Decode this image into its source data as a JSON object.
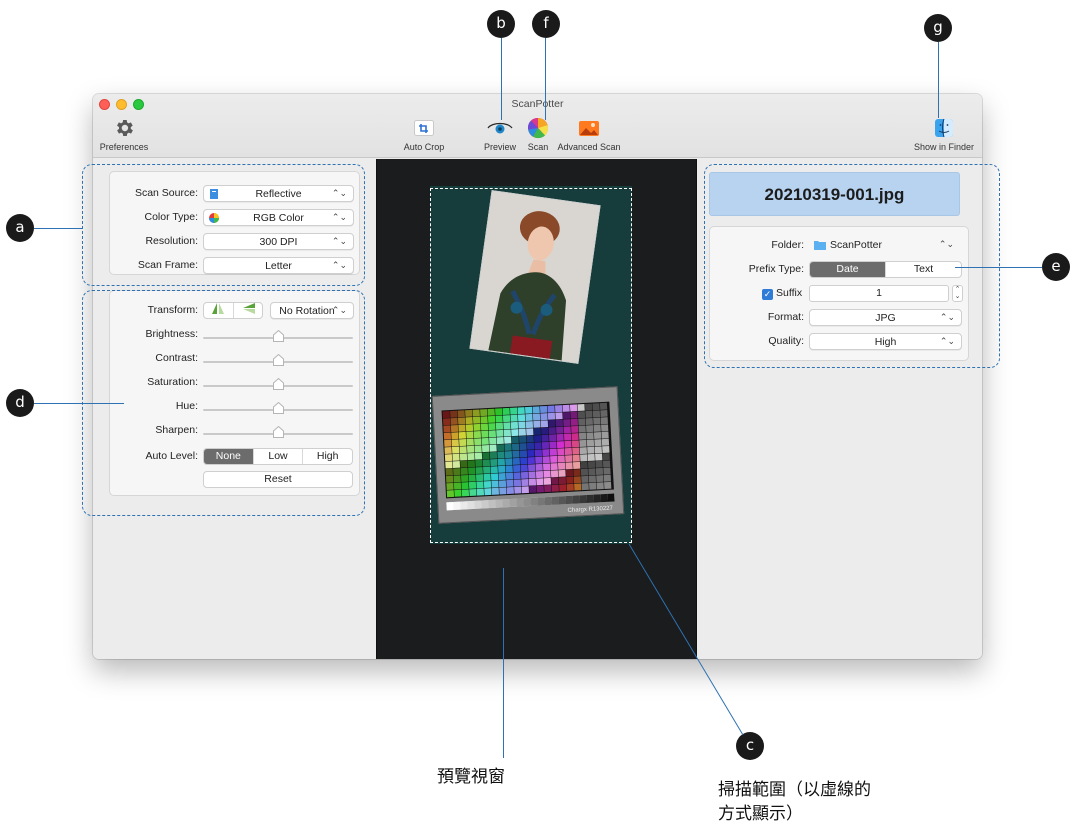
{
  "window": {
    "title": "ScanPotter"
  },
  "toolbar": {
    "preferences": "Preferences",
    "auto_crop": "Auto Crop",
    "preview": "Preview",
    "scan": "Scan",
    "advanced_scan": "Advanced Scan",
    "show_in_finder": "Show in Finder"
  },
  "scan_settings": {
    "scan_source_label": "Scan Source:",
    "scan_source_value": "Reflective",
    "color_type_label": "Color Type:",
    "color_type_value": "RGB Color",
    "resolution_label": "Resolution:",
    "resolution_value": "300 DPI",
    "scan_frame_label": "Scan Frame:",
    "scan_frame_value": "Letter"
  },
  "adjustments": {
    "transform_label": "Transform:",
    "rotation_value": "No Rotation",
    "sliders": [
      {
        "label": "Brightness:",
        "value": 0.5
      },
      {
        "label": "Contrast:",
        "value": 0.5
      },
      {
        "label": "Saturation:",
        "value": 0.5
      },
      {
        "label": "Hue:",
        "value": 0.5
      },
      {
        "label": "Sharpen:",
        "value": 0.5
      }
    ],
    "auto_level_label": "Auto Level:",
    "auto_level_options": [
      "None",
      "Low",
      "High"
    ],
    "auto_level_selected": "None",
    "reset": "Reset"
  },
  "output": {
    "filename": "20210319-001.jpg",
    "folder_label": "Folder:",
    "folder_value": "ScanPotter",
    "prefix_type_label": "Prefix Type:",
    "prefix_options": [
      "Date",
      "Text"
    ],
    "prefix_selected": "Date",
    "suffix_label": "Suffix",
    "suffix_checked": true,
    "suffix_value": "1",
    "format_label": "Format:",
    "format_value": "JPG",
    "quality_label": "Quality:",
    "quality_value": "High"
  },
  "callouts": {
    "a": "a",
    "b": "b",
    "c": "c",
    "d": "d",
    "e": "e",
    "f": "f",
    "g": "g"
  },
  "captions": {
    "preview_window": "預覽視窗",
    "scan_area_line1": "掃描範圍（以虛線的",
    "scan_area_line2": "方式顯示）"
  },
  "target": {
    "text": "Chargx R130227"
  },
  "colors": {
    "accent": "#2f72b3",
    "selected_segment": "#6c6c6c",
    "filename_bg": "#b7d3f0"
  }
}
